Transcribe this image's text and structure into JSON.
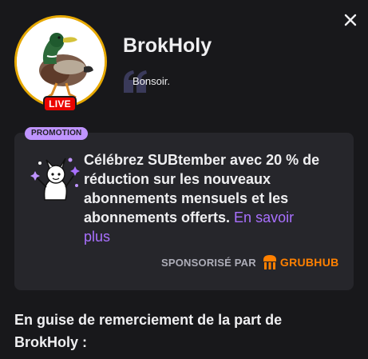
{
  "header": {
    "channel_name": "BrokHoly",
    "greeting": "Bonsoir.",
    "live_label": "LIVE"
  },
  "promotion": {
    "badge": "PROMOTION",
    "message": "Célébrez SUBtember avec 20 % de réduction sur les nouveaux abonnements mensuels et les abonnements offerts.",
    "link_label": "En savoir plus",
    "sponsored_by_label": "SPONSORISÉ PAR",
    "sponsor_name": "GRUBHUB"
  },
  "thanks": {
    "text": "En guise de remerciement de la part de BrokHoly :"
  },
  "colors": {
    "background": "#18181b",
    "card": "#26262b",
    "accent_purple": "#a970ff",
    "badge_purple": "#bf94ff",
    "live_red": "#eb0400",
    "avatar_ring": "#e6a800",
    "grubhub_orange": "#ff8000"
  },
  "icons": {
    "close": "close-icon",
    "quote": "quote-icon",
    "promo": "confetti-character-icon",
    "sponsor": "grubhub-logo-icon"
  }
}
